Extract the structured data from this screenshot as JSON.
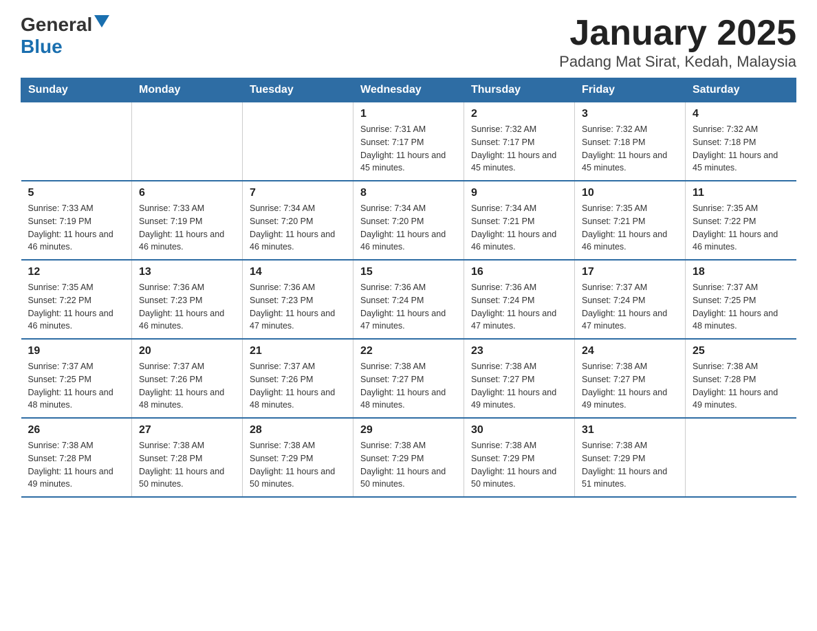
{
  "header": {
    "logo": {
      "general": "General",
      "blue": "Blue"
    },
    "title": "January 2025",
    "subtitle": "Padang Mat Sirat, Kedah, Malaysia"
  },
  "days_of_week": [
    "Sunday",
    "Monday",
    "Tuesday",
    "Wednesday",
    "Thursday",
    "Friday",
    "Saturday"
  ],
  "weeks": [
    [
      {
        "day": "",
        "info": ""
      },
      {
        "day": "",
        "info": ""
      },
      {
        "day": "",
        "info": ""
      },
      {
        "day": "1",
        "info": "Sunrise: 7:31 AM\nSunset: 7:17 PM\nDaylight: 11 hours and 45 minutes."
      },
      {
        "day": "2",
        "info": "Sunrise: 7:32 AM\nSunset: 7:17 PM\nDaylight: 11 hours and 45 minutes."
      },
      {
        "day": "3",
        "info": "Sunrise: 7:32 AM\nSunset: 7:18 PM\nDaylight: 11 hours and 45 minutes."
      },
      {
        "day": "4",
        "info": "Sunrise: 7:32 AM\nSunset: 7:18 PM\nDaylight: 11 hours and 45 minutes."
      }
    ],
    [
      {
        "day": "5",
        "info": "Sunrise: 7:33 AM\nSunset: 7:19 PM\nDaylight: 11 hours and 46 minutes."
      },
      {
        "day": "6",
        "info": "Sunrise: 7:33 AM\nSunset: 7:19 PM\nDaylight: 11 hours and 46 minutes."
      },
      {
        "day": "7",
        "info": "Sunrise: 7:34 AM\nSunset: 7:20 PM\nDaylight: 11 hours and 46 minutes."
      },
      {
        "day": "8",
        "info": "Sunrise: 7:34 AM\nSunset: 7:20 PM\nDaylight: 11 hours and 46 minutes."
      },
      {
        "day": "9",
        "info": "Sunrise: 7:34 AM\nSunset: 7:21 PM\nDaylight: 11 hours and 46 minutes."
      },
      {
        "day": "10",
        "info": "Sunrise: 7:35 AM\nSunset: 7:21 PM\nDaylight: 11 hours and 46 minutes."
      },
      {
        "day": "11",
        "info": "Sunrise: 7:35 AM\nSunset: 7:22 PM\nDaylight: 11 hours and 46 minutes."
      }
    ],
    [
      {
        "day": "12",
        "info": "Sunrise: 7:35 AM\nSunset: 7:22 PM\nDaylight: 11 hours and 46 minutes."
      },
      {
        "day": "13",
        "info": "Sunrise: 7:36 AM\nSunset: 7:23 PM\nDaylight: 11 hours and 46 minutes."
      },
      {
        "day": "14",
        "info": "Sunrise: 7:36 AM\nSunset: 7:23 PM\nDaylight: 11 hours and 47 minutes."
      },
      {
        "day": "15",
        "info": "Sunrise: 7:36 AM\nSunset: 7:24 PM\nDaylight: 11 hours and 47 minutes."
      },
      {
        "day": "16",
        "info": "Sunrise: 7:36 AM\nSunset: 7:24 PM\nDaylight: 11 hours and 47 minutes."
      },
      {
        "day": "17",
        "info": "Sunrise: 7:37 AM\nSunset: 7:24 PM\nDaylight: 11 hours and 47 minutes."
      },
      {
        "day": "18",
        "info": "Sunrise: 7:37 AM\nSunset: 7:25 PM\nDaylight: 11 hours and 48 minutes."
      }
    ],
    [
      {
        "day": "19",
        "info": "Sunrise: 7:37 AM\nSunset: 7:25 PM\nDaylight: 11 hours and 48 minutes."
      },
      {
        "day": "20",
        "info": "Sunrise: 7:37 AM\nSunset: 7:26 PM\nDaylight: 11 hours and 48 minutes."
      },
      {
        "day": "21",
        "info": "Sunrise: 7:37 AM\nSunset: 7:26 PM\nDaylight: 11 hours and 48 minutes."
      },
      {
        "day": "22",
        "info": "Sunrise: 7:38 AM\nSunset: 7:27 PM\nDaylight: 11 hours and 48 minutes."
      },
      {
        "day": "23",
        "info": "Sunrise: 7:38 AM\nSunset: 7:27 PM\nDaylight: 11 hours and 49 minutes."
      },
      {
        "day": "24",
        "info": "Sunrise: 7:38 AM\nSunset: 7:27 PM\nDaylight: 11 hours and 49 minutes."
      },
      {
        "day": "25",
        "info": "Sunrise: 7:38 AM\nSunset: 7:28 PM\nDaylight: 11 hours and 49 minutes."
      }
    ],
    [
      {
        "day": "26",
        "info": "Sunrise: 7:38 AM\nSunset: 7:28 PM\nDaylight: 11 hours and 49 minutes."
      },
      {
        "day": "27",
        "info": "Sunrise: 7:38 AM\nSunset: 7:28 PM\nDaylight: 11 hours and 50 minutes."
      },
      {
        "day": "28",
        "info": "Sunrise: 7:38 AM\nSunset: 7:29 PM\nDaylight: 11 hours and 50 minutes."
      },
      {
        "day": "29",
        "info": "Sunrise: 7:38 AM\nSunset: 7:29 PM\nDaylight: 11 hours and 50 minutes."
      },
      {
        "day": "30",
        "info": "Sunrise: 7:38 AM\nSunset: 7:29 PM\nDaylight: 11 hours and 50 minutes."
      },
      {
        "day": "31",
        "info": "Sunrise: 7:38 AM\nSunset: 7:29 PM\nDaylight: 11 hours and 51 minutes."
      },
      {
        "day": "",
        "info": ""
      }
    ]
  ]
}
